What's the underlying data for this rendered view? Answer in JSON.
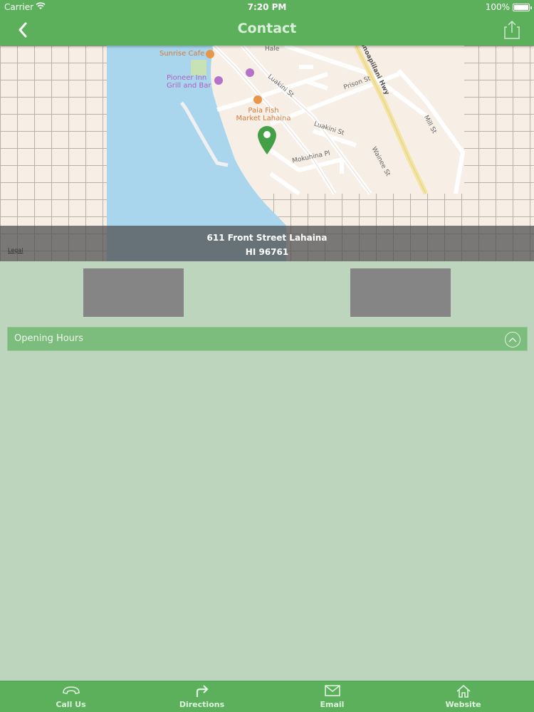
{
  "status_bar": {
    "carrier": "Carrier",
    "time": "7:20 PM",
    "battery": "100%",
    "battery_level": 1.0
  },
  "nav": {
    "title": "Contact",
    "back_icon": "chevron-left-icon",
    "share_icon": "share-icon"
  },
  "map": {
    "pois": [
      {
        "name": "Sunrise Cafe",
        "type": "restaurant"
      },
      {
        "name": "Pioneer Inn Grill and Bar",
        "type": "hotel"
      },
      {
        "name": "Paia Fish Market Lahaina",
        "type": "restaurant"
      }
    ],
    "roads": [
      "Hale",
      "Luakini St",
      "Prison St",
      "Luakini St",
      "Mokuhina Pl",
      "Wainee St",
      "Mill St",
      "Honoapiilani Hwy"
    ],
    "legal": "Legal",
    "address_line1": "611 Front Street Lahaina",
    "address_line2": "HI 96761",
    "pin_color": "#43a047"
  },
  "opening_hours": {
    "label": "Opening Hours",
    "icon": "chevron-up-circle-icon"
  },
  "tabs": [
    {
      "label": "Call Us",
      "icon": "phone-icon"
    },
    {
      "label": "Directions",
      "icon": "directions-arrow-icon"
    },
    {
      "label": "Email",
      "icon": "envelope-icon"
    },
    {
      "label": "Website",
      "icon": "home-icon"
    }
  ],
  "colors": {
    "accent": "#5cb05c",
    "background": "#bdd5bd",
    "tile": "#858585"
  }
}
